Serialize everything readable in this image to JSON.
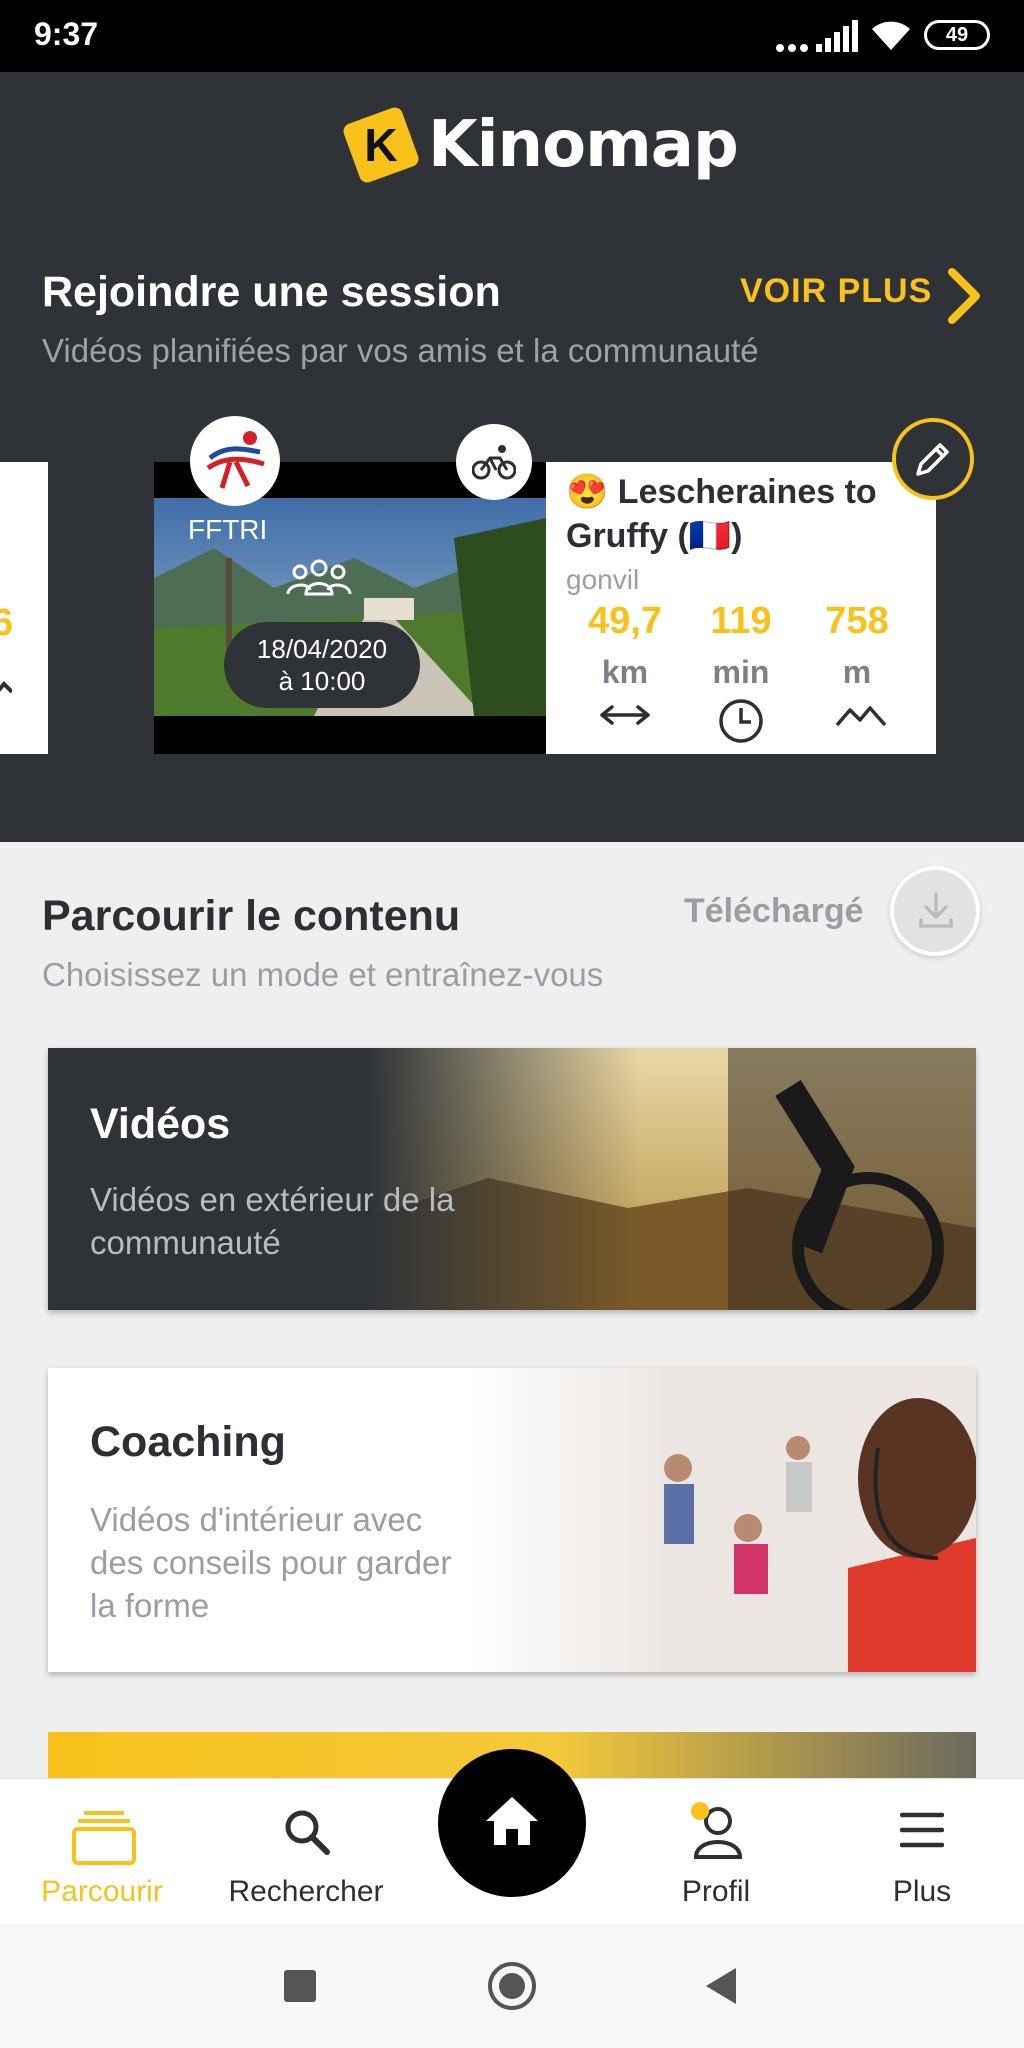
{
  "status_bar": {
    "time": "9:37",
    "battery": "49"
  },
  "brand": {
    "logo_letter": "K",
    "logo_text": "Kinomap",
    "accent": "#f8c21b"
  },
  "sessions": {
    "title": "Rejoindre une session",
    "subtitle": "Vidéos planifiées par vos amis et la communauté",
    "see_more": "VOIR PLUS",
    "prev_card_fragment": "6",
    "card": {
      "organizer": "FFTRI",
      "datetime_line1": "18/04/2020",
      "datetime_line2": "à 10:00",
      "title_emoji": "😍",
      "title": "Lescheraines to Gruffy (🇫🇷)",
      "author": "gonvil",
      "stats": [
        {
          "value": "49,7",
          "unit": "km",
          "icon": "distance-arrows-icon"
        },
        {
          "value": "119",
          "unit": "min",
          "icon": "clock-icon"
        },
        {
          "value": "758",
          "unit": "m",
          "icon": "elevation-icon"
        }
      ]
    }
  },
  "browse": {
    "title": "Parcourir le contenu",
    "subtitle": "Choisissez un mode et entraînez-vous",
    "downloaded_label": "Téléchargé",
    "modes": [
      {
        "title": "Vidéos",
        "subtitle_line1": "Vidéos en extérieur de la",
        "subtitle_line2": "communauté"
      },
      {
        "title": "Coaching",
        "subtitle_line1": "Vidéos d'intérieur avec",
        "subtitle_line2": "des conseils pour garder",
        "subtitle_line3": "la forme"
      }
    ]
  },
  "bottom_nav": {
    "items": [
      {
        "label": "Parcourir",
        "icon": "stack-icon",
        "active": true
      },
      {
        "label": "Rechercher",
        "icon": "search-icon"
      },
      {
        "label": "",
        "icon": "home-icon"
      },
      {
        "label": "Profil",
        "icon": "user-icon"
      },
      {
        "label": "Plus",
        "icon": "menu-icon"
      }
    ]
  }
}
